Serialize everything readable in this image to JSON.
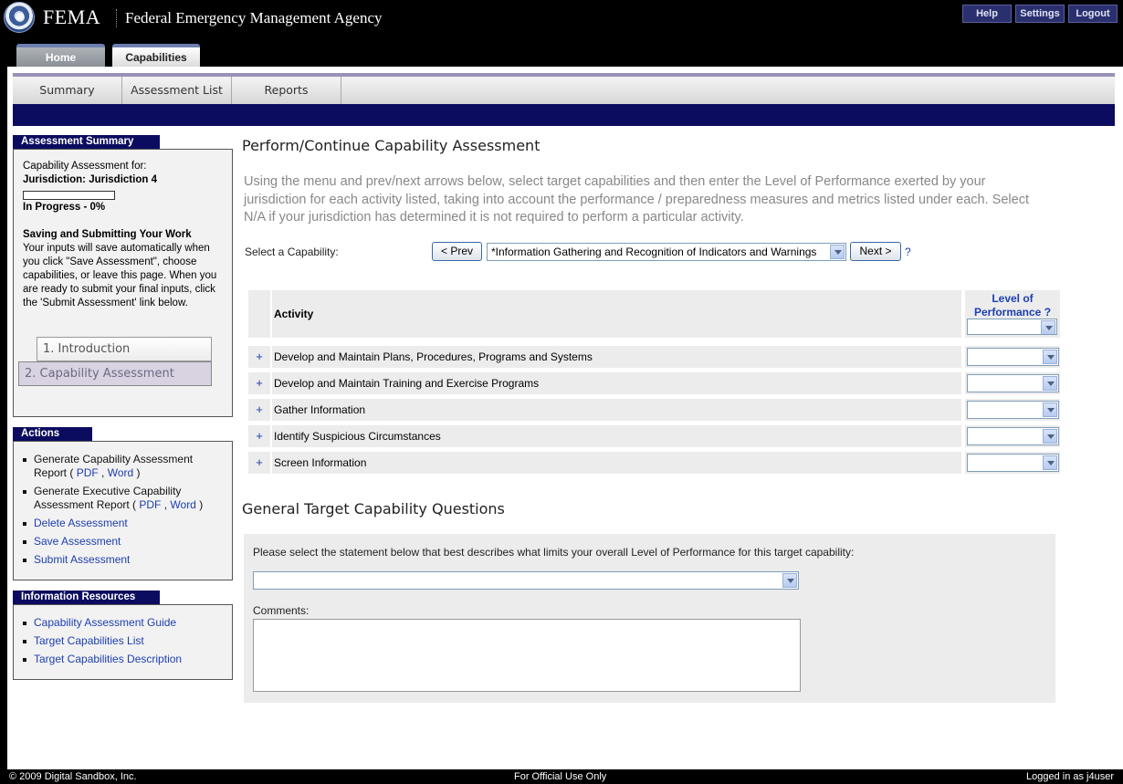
{
  "header": {
    "brand": "FEMA",
    "agency": "Federal Emergency Management Agency",
    "buttons": {
      "help": "Help",
      "settings": "Settings",
      "logout": "Logout"
    },
    "tabs": {
      "home": "Home",
      "capabilities": "Capabilities"
    }
  },
  "subnav": {
    "summary": "Summary",
    "assessment_list": "Assessment List",
    "reports": "Reports"
  },
  "sidebar": {
    "summary_title": "Assessment Summary",
    "cap_for": "Capability Assessment for:",
    "jurisdiction": "Jurisdiction: Jurisdiction 4",
    "progress_percent": 0,
    "status": "In Progress - 0%",
    "saving_title": "Saving and Submitting Your Work",
    "saving_body": "Your inputs will save automatically when you click \"Save Assessment\", choose capabilities, or leave this page. When you are ready to submit your final inputs, click the 'Submit Assessment' link below.",
    "steps": {
      "introduction": "1. Introduction",
      "capability_assessment": "2. Capability Assessment"
    },
    "actions_title": "Actions",
    "actions": {
      "gen_report": "Generate Capability Assessment Report (",
      "gen_report_pdf": "PDF",
      "gen_report_word": "Word",
      "gen_exec": "Generate Executive Capability Assessment Report (",
      "gen_exec_pdf": "PDF",
      "gen_exec_word": "Word",
      "delete": "Delete Assessment",
      "save": "Save Assessment",
      "submit": "Submit Assessment"
    },
    "resources_title": "Information Resources",
    "resources": {
      "guide": "Capability Assessment Guide",
      "list": "Target Capabilities List",
      "description": "Target Capabilities Description"
    }
  },
  "main": {
    "title": "Perform/Continue Capability Assessment",
    "instructions": "Using the menu and prev/next arrows below, select target capabilities and then enter the Level of Performance exerted by your jurisdiction for each activity listed, taking into account the performance / preparedness measures and metrics listed under each. Select N/A if your jurisdiction has determined it is not required to perform a particular activity.",
    "select_label": "Select a Capability:",
    "prev": "< Prev",
    "next": "Next >",
    "selected_capability": "*Information Gathering and Recognition of Indicators and Warnings",
    "help": "?",
    "table": {
      "activity_header": "Activity",
      "level_header": "Level of Performance",
      "level_help": "?",
      "expand": "+",
      "rows": [
        "Develop and Maintain Plans, Procedures, Programs and Systems",
        "Develop and Maintain Training and Exercise Programs",
        "Gather Information",
        "Identify Suspicious Circumstances",
        "Screen Information"
      ]
    },
    "general_title": "General Target Capability Questions",
    "general_prompt": "Please select the statement below that best describes what limits your overall Level of Performance for this target capability:",
    "comments_label": "Comments:"
  },
  "footer": {
    "copyright": "© 2009 Digital Sandbox, Inc.",
    "official": "For Official Use Only",
    "logged_in": "Logged in as j4user"
  }
}
